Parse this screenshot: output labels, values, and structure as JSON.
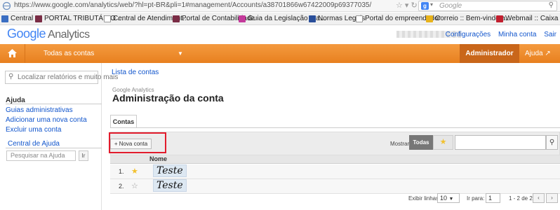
{
  "browser": {
    "url": "https://www.google.com/analytics/web/?hl=pt-BR&pli=1#management/Accounts/a38701866w67422009p69377035/",
    "search_engine": "Google",
    "bookmarks": [
      "Central Jé",
      "PORTAL TRIBUTÁRIO ...",
      "Central de Atendiment...",
      "Portal de Contabilidade",
      "Guia da Legislação Tra...",
      "Normas Legais",
      "Portal do empreendedor",
      "Correio :: Bem-vindo a...",
      "Webmail :: Caixa de en..."
    ]
  },
  "header": {
    "logo_google": "Google",
    "logo_analytics": "Analytics",
    "links": [
      "Configurações",
      "Minha conta",
      "Sair"
    ]
  },
  "navbar": {
    "account_selector": "Todas as contas",
    "admin": "Administrador",
    "help": "Ajuda"
  },
  "sidebar": {
    "search_placeholder": "Localizar relatórios e muito mais",
    "section_title": "Ajuda",
    "links": [
      "Guias administrativas",
      "Adicionar uma nova conta",
      "Excluir uma conta"
    ],
    "help_center": "Central de Ajuda",
    "help_search_placeholder": "Pesquisar na Ajuda",
    "help_go": "Ir"
  },
  "main": {
    "breadcrumb": "Lista de contas",
    "kicker": "Google Analytics",
    "title": "Administração da conta",
    "tab": "Contas",
    "new_button": "+ Nova conta",
    "show_label": "Mostrar",
    "filter_all": "Todas",
    "column_name": "Nome",
    "rows": [
      {
        "num": "1.",
        "starred": true,
        "name": "Teste"
      },
      {
        "num": "2.",
        "starred": false,
        "name": "Teste"
      }
    ],
    "pager": {
      "rows_label": "Exibir linhas:",
      "rows_value": "10",
      "goto_label": "Ir para:",
      "goto_value": "1",
      "range": "1 - 2 de 2"
    }
  },
  "colors": {
    "nav_orange": "#ef8a2d",
    "highlight_red": "#e21c2c",
    "link_blue": "#1155cc"
  }
}
